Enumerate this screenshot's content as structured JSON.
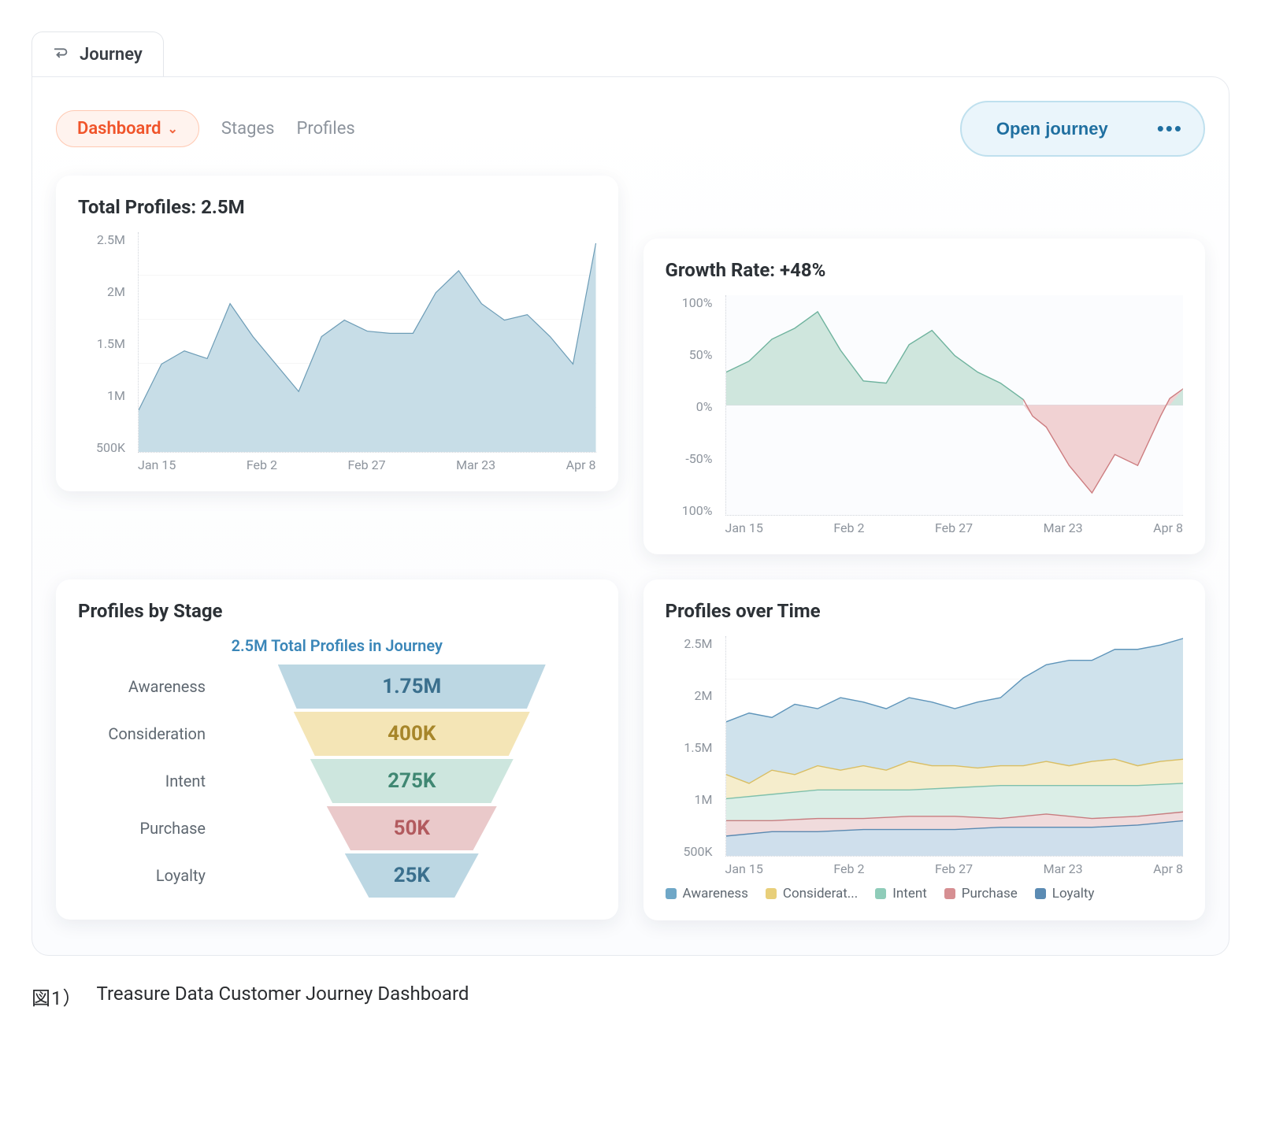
{
  "app_tab": {
    "label": "Journey"
  },
  "subnav": {
    "dashboard": "Dashboard",
    "stages": "Stages",
    "profiles": "Profiles"
  },
  "actions": {
    "open": "Open journey",
    "more": "•••"
  },
  "caption": {
    "figno": "図1）",
    "text": "Treasure Data Customer Journey Dashboard"
  },
  "cards": {
    "total_profiles": {
      "title": "Total Profiles: 2.5M"
    },
    "growth_rate": {
      "title": "Growth Rate: +48%"
    },
    "profiles_by_stage": {
      "title": "Profiles by Stage",
      "subtitle": "2.5M Total Profiles in Journey"
    },
    "profiles_over_time": {
      "title": "Profiles over Time"
    }
  },
  "funnel": {
    "rows": [
      {
        "label": "Awareness",
        "value": "1.75M"
      },
      {
        "label": "Consideration",
        "value": "400K"
      },
      {
        "label": "Intent",
        "value": "275K"
      },
      {
        "label": "Purchase",
        "value": "50K"
      },
      {
        "label": "Loyalty",
        "value": "25K"
      }
    ]
  },
  "legend": {
    "awareness": "Awareness",
    "consideration": "Considerat...",
    "intent": "Intent",
    "purchase": "Purchase",
    "loyalty": "Loyalty"
  },
  "chart_data": [
    {
      "id": "total_profiles",
      "type": "area",
      "title": "Total Profiles: 2.5M",
      "ylabel": "profiles",
      "y_ticks": [
        "2.5M",
        "2M",
        "1.5M",
        "1M",
        "500K"
      ],
      "x_ticks": [
        "Jan 15",
        "Feb 2",
        "Feb 27",
        "Mar 23",
        "Apr 8"
      ],
      "ylim": [
        500000,
        2500000
      ],
      "values_millions": [
        0.88,
        1.3,
        1.42,
        1.35,
        1.85,
        1.55,
        1.3,
        1.05,
        1.55,
        1.7,
        1.6,
        1.58,
        1.58,
        1.95,
        2.15,
        1.85,
        1.7,
        1.75,
        1.55,
        1.3,
        2.4
      ]
    },
    {
      "id": "growth_rate",
      "type": "area",
      "title": "Growth Rate: +48%",
      "ylabel": "%",
      "y_ticks": [
        "100%",
        "50%",
        "0%",
        "-50%",
        "100%"
      ],
      "x_ticks": [
        "Jan 15",
        "Feb 2",
        "Feb 27",
        "Mar 23",
        "Apr 8"
      ],
      "ylim": [
        -100,
        100
      ],
      "values_pct": [
        30,
        40,
        60,
        70,
        85,
        50,
        22,
        20,
        55,
        68,
        45,
        30,
        20,
        5,
        -20,
        -55,
        -80,
        -45,
        -55,
        -10,
        15
      ],
      "color_split": "zero-baseline: green above, red below"
    },
    {
      "id": "profiles_by_stage_funnel",
      "type": "bar",
      "title": "Profiles by Stage",
      "subtitle": "2.5M Total Profiles in Journey",
      "categories": [
        "Awareness",
        "Consideration",
        "Intent",
        "Purchase",
        "Loyalty"
      ],
      "values": [
        1750000,
        400000,
        275000,
        50000,
        25000
      ]
    },
    {
      "id": "profiles_over_time",
      "type": "area",
      "title": "Profiles over Time",
      "y_ticks": [
        "2.5M",
        "2M",
        "1.5M",
        "1M",
        "500K"
      ],
      "x_ticks": [
        "Jan 15",
        "Feb 2",
        "Feb 27",
        "Mar 23",
        "Apr 8"
      ],
      "ylim": [
        0,
        2700000
      ],
      "series": [
        {
          "name": "Awareness",
          "color": "#6fa7c7",
          "values_millions": [
            1.65,
            1.75,
            1.7,
            1.85,
            1.8,
            1.95,
            1.9,
            1.8,
            1.95,
            1.9,
            1.8,
            1.88,
            1.95,
            2.2,
            2.35,
            2.4,
            2.4,
            2.55,
            2.55,
            2.6,
            2.68
          ]
        },
        {
          "name": "Consideration",
          "color": "#e8cf7a",
          "values_millions": [
            1.0,
            0.9,
            1.05,
            1.0,
            1.1,
            1.05,
            1.12,
            1.05,
            1.15,
            1.1,
            1.12,
            1.08,
            1.12,
            1.1,
            1.15,
            1.12,
            1.15,
            1.2,
            1.12,
            1.15,
            1.18
          ]
        },
        {
          "name": "Intent",
          "color": "#8fccb9",
          "values_millions": [
            0.7,
            0.72,
            0.75,
            0.78,
            0.8,
            0.78,
            0.8,
            0.8,
            0.82,
            0.8,
            0.83,
            0.82,
            0.85,
            0.84,
            0.86,
            0.85,
            0.85,
            0.88,
            0.85,
            0.88,
            0.9
          ]
        },
        {
          "name": "Purchase",
          "color": "#d68f92",
          "values_millions": [
            0.42,
            0.38,
            0.42,
            0.4,
            0.45,
            0.42,
            0.45,
            0.42,
            0.48,
            0.45,
            0.48,
            0.42,
            0.45,
            0.48,
            0.5,
            0.52,
            0.45,
            0.52,
            0.48,
            0.55,
            0.55
          ]
        },
        {
          "name": "Loyalty",
          "color": "#5b8bb3",
          "values_millions": [
            0.25,
            0.28,
            0.3,
            0.28,
            0.3,
            0.3,
            0.32,
            0.3,
            0.32,
            0.3,
            0.32,
            0.32,
            0.34,
            0.35,
            0.36,
            0.35,
            0.36,
            0.38,
            0.38,
            0.4,
            0.42
          ]
        }
      ]
    }
  ]
}
